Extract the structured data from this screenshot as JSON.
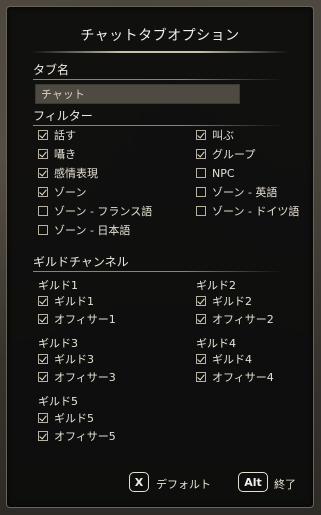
{
  "window": {
    "title": "チャットタブオプション"
  },
  "tab_name": {
    "label": "タブ名",
    "value": "チャット"
  },
  "filters": {
    "label": "フィルター",
    "left": [
      {
        "label": "話す",
        "checked": true
      },
      {
        "label": "囁き",
        "checked": true
      },
      {
        "label": "感情表現",
        "checked": true
      },
      {
        "label": "ゾーン",
        "checked": true
      },
      {
        "label": "ゾーン - フランス語",
        "checked": false
      },
      {
        "label": "ゾーン - 日本語",
        "checked": false
      }
    ],
    "right": [
      {
        "label": "叫ぶ",
        "checked": true
      },
      {
        "label": "グループ",
        "checked": true
      },
      {
        "label": "NPC",
        "checked": false
      },
      {
        "label": "ゾーン - 英語",
        "checked": false
      },
      {
        "label": "ゾーン - ドイツ語",
        "checked": false
      }
    ]
  },
  "guild_channels": {
    "label": "ギルドチャンネル",
    "guilds": [
      {
        "name": "ギルド1",
        "items": [
          {
            "label": "ギルド1",
            "checked": true
          },
          {
            "label": "オフィサー1",
            "checked": true
          }
        ]
      },
      {
        "name": "ギルド2",
        "items": [
          {
            "label": "ギルド2",
            "checked": true
          },
          {
            "label": "オフィサー2",
            "checked": true
          }
        ]
      },
      {
        "name": "ギルド3",
        "items": [
          {
            "label": "ギルド3",
            "checked": true
          },
          {
            "label": "オフィサー3",
            "checked": true
          }
        ]
      },
      {
        "name": "ギルド4",
        "items": [
          {
            "label": "ギルド4",
            "checked": true
          },
          {
            "label": "オフィサー4",
            "checked": true
          }
        ]
      },
      {
        "name": "ギルド5",
        "items": [
          {
            "label": "ギルド5",
            "checked": true
          },
          {
            "label": "オフィサー5",
            "checked": true
          }
        ]
      }
    ]
  },
  "footer": {
    "default_key": "X",
    "default_label": "デフォルト",
    "exit_key": "Alt",
    "exit_label": "終了"
  }
}
